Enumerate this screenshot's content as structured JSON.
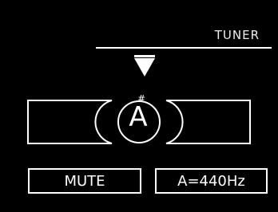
{
  "screen": {
    "title": "TUNER"
  },
  "note": {
    "letter": "A",
    "accidental": "#"
  },
  "buttons": {
    "mute_label": "MUTE",
    "reference_label": "A=440Hz"
  },
  "icons": {
    "pointer": "down-triangle-icon"
  },
  "colors": {
    "background": "#000000",
    "foreground": "#ffffff"
  }
}
